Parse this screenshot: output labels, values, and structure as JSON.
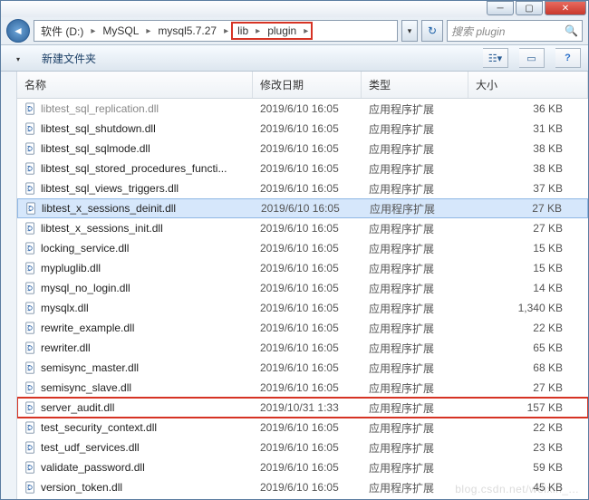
{
  "window": {
    "min_label": "─",
    "max_label": "▢",
    "close_label": "✕"
  },
  "breadcrumb": {
    "drive": "软件 (D:)",
    "p1": "MySQL",
    "p2": "mysql5.7.27",
    "p3": "lib",
    "p4": "plugin",
    "sep": "▸"
  },
  "search": {
    "placeholder": "搜索 plugin"
  },
  "toolbar": {
    "new_folder": "新建文件夹",
    "menu_tri": "▾"
  },
  "columns": {
    "name": "名称",
    "date": "修改日期",
    "type": "类型",
    "size": "大小"
  },
  "files": [
    {
      "name": "libtest_sql_replication.dll",
      "date": "2019/6/10 16:05",
      "type": "应用程序扩展",
      "size": "36 KB",
      "dim": true
    },
    {
      "name": "libtest_sql_shutdown.dll",
      "date": "2019/6/10 16:05",
      "type": "应用程序扩展",
      "size": "31 KB"
    },
    {
      "name": "libtest_sql_sqlmode.dll",
      "date": "2019/6/10 16:05",
      "type": "应用程序扩展",
      "size": "38 KB"
    },
    {
      "name": "libtest_sql_stored_procedures_functi...",
      "date": "2019/6/10 16:05",
      "type": "应用程序扩展",
      "size": "38 KB"
    },
    {
      "name": "libtest_sql_views_triggers.dll",
      "date": "2019/6/10 16:05",
      "type": "应用程序扩展",
      "size": "37 KB"
    },
    {
      "name": "libtest_x_sessions_deinit.dll",
      "date": "2019/6/10 16:05",
      "type": "应用程序扩展",
      "size": "27 KB",
      "selected": true
    },
    {
      "name": "libtest_x_sessions_init.dll",
      "date": "2019/6/10 16:05",
      "type": "应用程序扩展",
      "size": "27 KB"
    },
    {
      "name": "locking_service.dll",
      "date": "2019/6/10 16:05",
      "type": "应用程序扩展",
      "size": "15 KB"
    },
    {
      "name": "mypluglib.dll",
      "date": "2019/6/10 16:05",
      "type": "应用程序扩展",
      "size": "15 KB"
    },
    {
      "name": "mysql_no_login.dll",
      "date": "2019/6/10 16:05",
      "type": "应用程序扩展",
      "size": "14 KB"
    },
    {
      "name": "mysqlx.dll",
      "date": "2019/6/10 16:05",
      "type": "应用程序扩展",
      "size": "1,340 KB"
    },
    {
      "name": "rewrite_example.dll",
      "date": "2019/6/10 16:05",
      "type": "应用程序扩展",
      "size": "22 KB"
    },
    {
      "name": "rewriter.dll",
      "date": "2019/6/10 16:05",
      "type": "应用程序扩展",
      "size": "65 KB"
    },
    {
      "name": "semisync_master.dll",
      "date": "2019/6/10 16:05",
      "type": "应用程序扩展",
      "size": "68 KB"
    },
    {
      "name": "semisync_slave.dll",
      "date": "2019/6/10 16:05",
      "type": "应用程序扩展",
      "size": "27 KB"
    },
    {
      "name": "server_audit.dll",
      "date": "2019/10/31 1:33",
      "type": "应用程序扩展",
      "size": "157 KB",
      "highlight": true
    },
    {
      "name": "test_security_context.dll",
      "date": "2019/6/10 16:05",
      "type": "应用程序扩展",
      "size": "22 KB"
    },
    {
      "name": "test_udf_services.dll",
      "date": "2019/6/10 16:05",
      "type": "应用程序扩展",
      "size": "23 KB"
    },
    {
      "name": "validate_password.dll",
      "date": "2019/6/10 16:05",
      "type": "应用程序扩展",
      "size": "59 KB"
    },
    {
      "name": "version_token.dll",
      "date": "2019/6/10 16:05",
      "type": "应用程序扩展",
      "size": "45 KB"
    }
  ]
}
